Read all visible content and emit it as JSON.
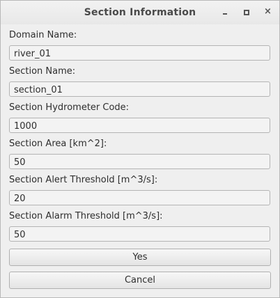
{
  "window": {
    "title": "Section Information"
  },
  "form": {
    "domain_name_label": "Domain Name:",
    "domain_name_value": "river_01",
    "section_name_label": "Section Name:",
    "section_name_value": "section_01",
    "hydrometer_code_label": "Section Hydrometer Code:",
    "hydrometer_code_value": "1000",
    "area_label": "Section Area [km^2]:",
    "area_value": "50",
    "alert_threshold_label": "Section Alert Threshold [m^3/s]:",
    "alert_threshold_value": "20",
    "alarm_threshold_label": "Section Alarm Threshold [m^3/s]:",
    "alarm_threshold_value": "50"
  },
  "buttons": {
    "yes_label": "Yes",
    "cancel_label": "Cancel"
  },
  "icons": {
    "minimize": "minimize-icon",
    "maximize": "maximize-icon",
    "close": "close-icon"
  }
}
